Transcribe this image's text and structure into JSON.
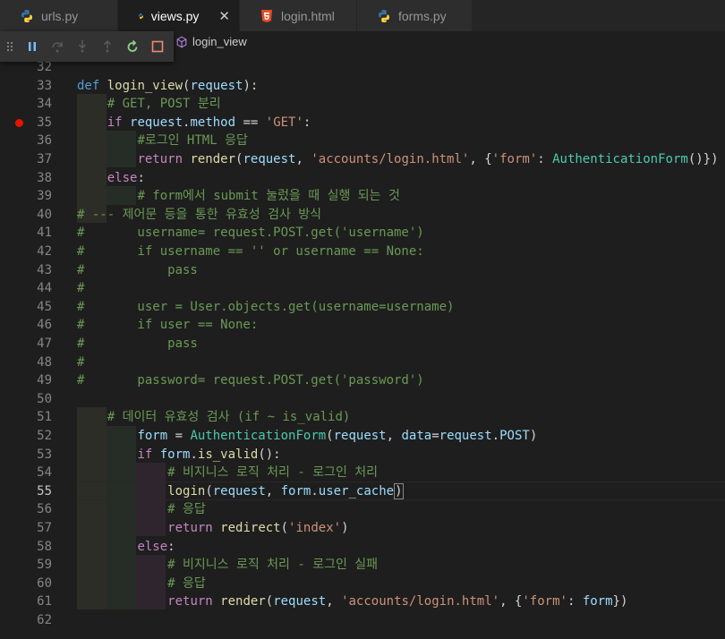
{
  "tabs": [
    {
      "label": "urls.py",
      "icon": "python-icon",
      "active": false
    },
    {
      "label": "views.py",
      "icon": "python-icon",
      "active": true,
      "close": "✕"
    },
    {
      "label": "login.html",
      "icon": "html5-icon",
      "active": false
    },
    {
      "label": "forms.py",
      "icon": "python-icon",
      "active": false
    }
  ],
  "breadcrumb": {
    "symbol": "login_view",
    "icon": "cube-icon"
  },
  "debug_toolbar": [
    "drag-handle",
    "pause",
    "step-over",
    "step-into",
    "step-out",
    "restart",
    "stop"
  ],
  "colors": {
    "breakpoint": "#e51400",
    "python_blue": "#3572a5",
    "python_yellow": "#ffd43b",
    "html_orange": "#e44d26",
    "restart_green": "#89d185",
    "stop_red": "#f48771"
  },
  "editor": {
    "cursor_line": 55,
    "breakpoint_line": 35,
    "lines": [
      {
        "n": "32",
        "text": ""
      },
      {
        "n": "33",
        "text": "def login_view(request):"
      },
      {
        "n": "34",
        "text": "    # GET, POST 분리"
      },
      {
        "n": "35",
        "text": "    if request.method == 'GET':"
      },
      {
        "n": "36",
        "text": "        #로그인 HTML 응답"
      },
      {
        "n": "37",
        "text": "        return render(request, 'accounts/login.html', {'form': AuthenticationForm()})"
      },
      {
        "n": "38",
        "text": "    else:"
      },
      {
        "n": "39",
        "text": "        # form에서 submit 눌렀을 때 실행 되는 것"
      },
      {
        "n": "40",
        "text": "# --- 제어문 등을 통한 유효성 검사 방식"
      },
      {
        "n": "41",
        "text": "#       username= request.POST.get('username')"
      },
      {
        "n": "42",
        "text": "#       if username == '' or username == None:"
      },
      {
        "n": "43",
        "text": "#           pass"
      },
      {
        "n": "44",
        "text": "#"
      },
      {
        "n": "45",
        "text": "#       user = User.objects.get(username=username)"
      },
      {
        "n": "46",
        "text": "#       if user == None:"
      },
      {
        "n": "47",
        "text": "#           pass"
      },
      {
        "n": "48",
        "text": "#"
      },
      {
        "n": "49",
        "text": "#       password= request.POST.get('password')"
      },
      {
        "n": "50",
        "text": ""
      },
      {
        "n": "51",
        "text": "    # 데이터 유효성 검사 (if ~ is_valid)"
      },
      {
        "n": "52",
        "text": "        form = AuthenticationForm(request, data=request.POST)"
      },
      {
        "n": "53",
        "text": "        if form.is_valid():"
      },
      {
        "n": "54",
        "text": "            # 비지니스 로직 처리 - 로그인 처리"
      },
      {
        "n": "55",
        "text": "            login(request, form.user_cache)"
      },
      {
        "n": "56",
        "text": "            # 응답"
      },
      {
        "n": "57",
        "text": "            return redirect('index')"
      },
      {
        "n": "58",
        "text": "        else:"
      },
      {
        "n": "59",
        "text": "            # 비지니스 로직 처리 - 로그인 실패"
      },
      {
        "n": "60",
        "text": "            # 응답"
      },
      {
        "n": "61",
        "text": "            return render(request, 'accounts/login.html', {'form': form})"
      },
      {
        "n": "62",
        "text": ""
      }
    ]
  }
}
